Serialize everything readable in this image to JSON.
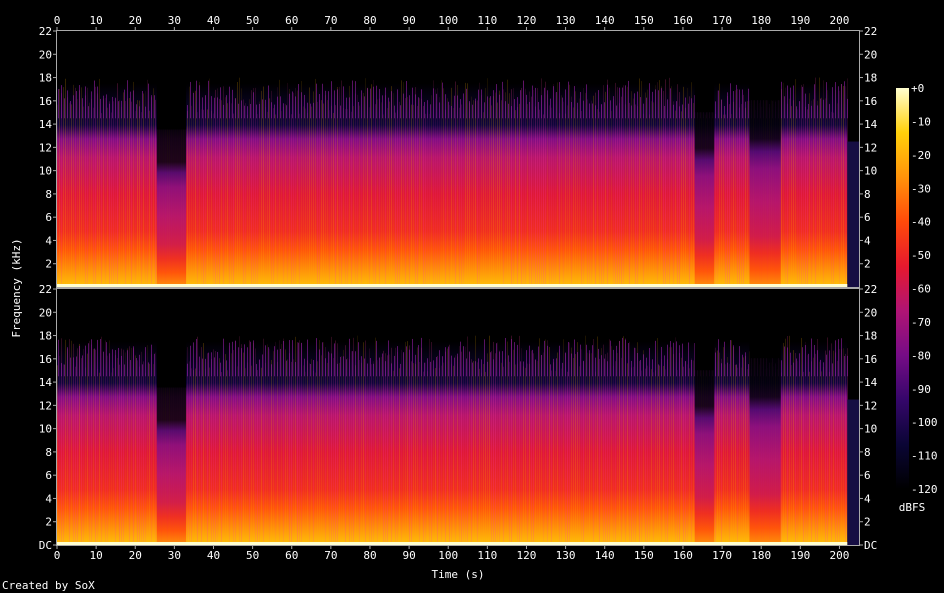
{
  "chart_data": {
    "type": "heatmap",
    "title": "",
    "xlabel": "Time (s)",
    "ylabel": "Frequency (kHz)",
    "colorbar_label": "dBFS",
    "credit": "Created by SoX",
    "x_range": [
      0,
      205
    ],
    "x_ticks": [
      "0",
      "10",
      "20",
      "30",
      "40",
      "50",
      "60",
      "70",
      "80",
      "90",
      "100",
      "110",
      "120",
      "130",
      "140",
      "150",
      "160",
      "170",
      "180",
      "190",
      "200"
    ],
    "y_range": [
      0,
      22
    ],
    "y_ticks_top": [
      "22",
      "20",
      "18",
      "16",
      "14",
      "12",
      "10",
      "8",
      "6",
      "4",
      "2"
    ],
    "y_ticks_bottom": [
      "22",
      "20",
      "18",
      "16",
      "14",
      "12",
      "10",
      "8",
      "6",
      "4",
      "2",
      "DC"
    ],
    "colorbar_ticks": [
      "+0",
      "-10",
      "-20",
      "-30",
      "-40",
      "-50",
      "-60",
      "-70",
      "-80",
      "-90",
      "-100",
      "-110",
      "-120"
    ],
    "colorbar_range": [
      -120,
      0
    ],
    "colorbar_colors": [
      "#000000",
      "#0a0535",
      "#35066a",
      "#760c86",
      "#b01474",
      "#e6192e",
      "#ff4a0a",
      "#ff930a",
      "#ffd00a",
      "#ffffd0"
    ],
    "channels": 2,
    "content_end_time": 202,
    "quiet_sections": [
      {
        "start": 25.5,
        "end": 33,
        "top_khz": 13.5
      },
      {
        "start": 163,
        "end": 168,
        "top_khz": 15
      },
      {
        "start": 177,
        "end": 185,
        "top_khz": 16
      }
    ],
    "spectral_profile_db": [
      {
        "khz": 0,
        "db": -5
      },
      {
        "khz": 0.3,
        "db": -18
      },
      {
        "khz": 2,
        "db": -28
      },
      {
        "khz": 4,
        "db": -38
      },
      {
        "khz": 6,
        "db": -48
      },
      {
        "khz": 10,
        "db": -55
      },
      {
        "khz": 14,
        "db": -65
      },
      {
        "khz": 16,
        "db": -78
      },
      {
        "khz": 17.5,
        "db": -105
      }
    ]
  }
}
